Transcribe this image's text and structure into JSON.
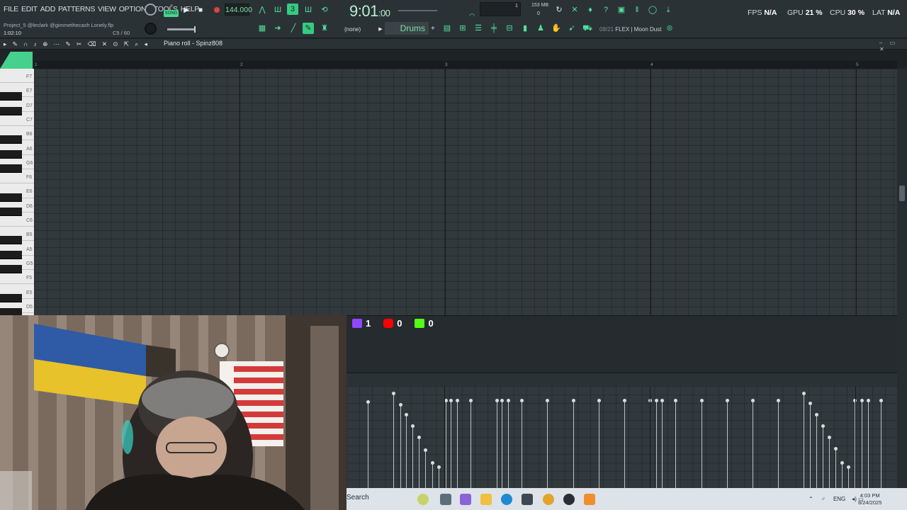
{
  "menu": [
    "FILE",
    "EDIT",
    "ADD",
    "PATTERNS",
    "VIEW",
    "OPTIONS",
    "TOOLS",
    "HELP"
  ],
  "hint": {
    "line1": "Project_5 @leclark @gimmethecash Lonely.flp",
    "line2": "1:02:10",
    "line2_right": "C5 / 60"
  },
  "transport": {
    "mode_label": "SONG",
    "tempo": "144.000",
    "time_main": "9:01",
    "time_sub": ":00"
  },
  "monitor": {
    "value1": "1",
    "value2": "0",
    "memory": "153 MB"
  },
  "stats": [
    {
      "label": "FPS",
      "value": "N/A"
    },
    {
      "label": "GPU",
      "value": "21 %"
    },
    {
      "label": "CPU",
      "value": "30 %"
    },
    {
      "label": "LAT",
      "value": "N/A"
    }
  ],
  "row2": {
    "channel_select": "(none)",
    "pattern_name": "Drums",
    "hint_counter": "08/21",
    "hint_text": "FLEX | Moon Dust"
  },
  "piano_roll": {
    "title": "Piano roll - Spinz808",
    "bars": [
      "1",
      "2",
      "3",
      "4",
      "5"
    ],
    "key_labels": [
      "F7",
      "E7",
      "D7",
      "C7",
      "B6",
      "A6",
      "G6",
      "F6",
      "E6",
      "D6",
      "C6",
      "B5",
      "A5",
      "G5",
      "F5",
      "E5",
      "D5"
    ]
  },
  "overlay": [
    {
      "platform": "twitch-icon",
      "count": "1",
      "color": "#9146ff"
    },
    {
      "platform": "youtube-icon",
      "count": "0",
      "color": "#ff0000"
    },
    {
      "platform": "kick-icon",
      "count": "0",
      "color": "#53fc18"
    }
  ],
  "taskbar": {
    "search": "Search",
    "lang": "ENG",
    "time": "4:03 PM",
    "date": "8/24/2025"
  }
}
